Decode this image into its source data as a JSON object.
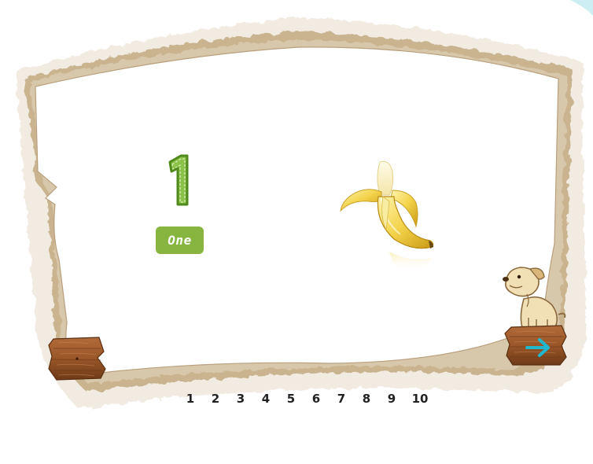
{
  "game": {
    "numeral": "1",
    "word": "One",
    "item_icon": "banana",
    "mascot_icon": "dog",
    "prev_icon": "wooden-plank",
    "next_icon": "arrow-right",
    "accent_green": "#87b53f",
    "arrow_color": "#1fb8cf"
  },
  "pager": {
    "pages": [
      "1",
      "2",
      "3",
      "4",
      "5",
      "6",
      "7",
      "8",
      "9",
      "10"
    ],
    "current": "1"
  }
}
